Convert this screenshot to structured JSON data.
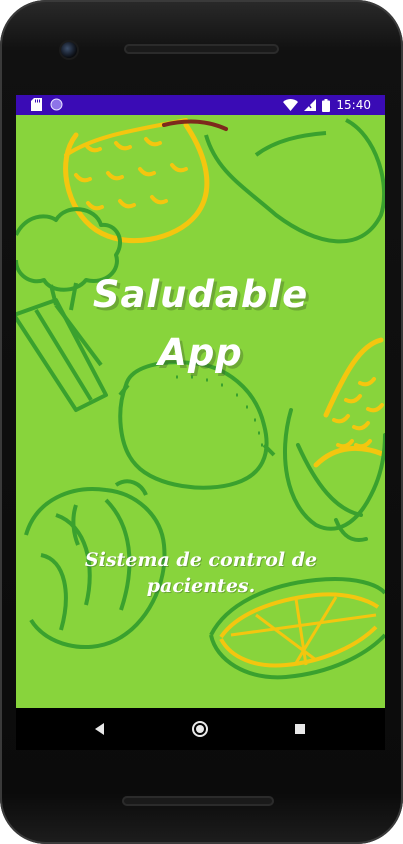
{
  "status_bar": {
    "time": "15:40",
    "left_icons": [
      "sd-card-icon",
      "circle-notification-icon"
    ],
    "right_icons": [
      "wifi-icon",
      "signal-icon",
      "battery-icon"
    ],
    "background_color": "#3a0bb5"
  },
  "splash": {
    "title_line1": "Saludable",
    "title_line2": "App",
    "subtitle": "Sistema de control de pacientes.",
    "background_color": "#88d43c",
    "illustration": [
      "pineapple",
      "pear",
      "broccoli",
      "lemon",
      "corn",
      "cabbage",
      "orange-slice"
    ]
  },
  "nav_bar": {
    "buttons": [
      "back-icon",
      "home-icon",
      "recents-icon"
    ]
  }
}
